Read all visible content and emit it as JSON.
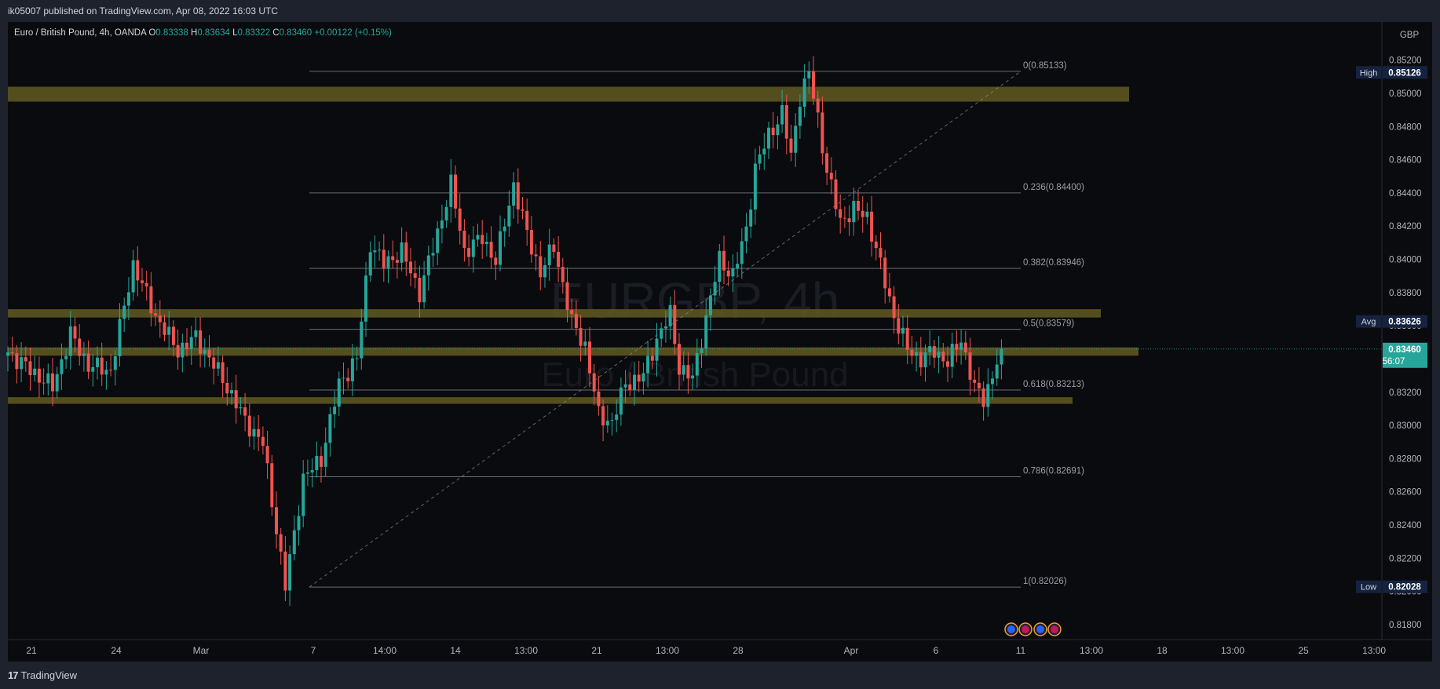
{
  "header": {
    "published": "ik05007 published on TradingView.com, Apr 08, 2022 16:03 UTC"
  },
  "footer": {
    "brand": "TradingView",
    "brand_icon": "tradingview-logo"
  },
  "colors": {
    "up": "#26a69a",
    "down": "#ef5350",
    "zone": "#5c5521",
    "fib": "#8a8d94",
    "fibText": "#9b9ea6",
    "bg": "#0a0b0e",
    "panel": "#1e222d",
    "price": "#26a69a",
    "labelBox": "#152340"
  },
  "chart_data": {
    "type": "candlestick",
    "title": "Euro / British Pound, 4h, OANDA",
    "ohlc_legend": {
      "o_label": "O",
      "o": "0.83338",
      "h_label": "H",
      "h": "0.83634",
      "l_label": "L",
      "l": "0.83322",
      "c_label": "C",
      "c": "0.83460",
      "change": "+0.00122 (+0.15%)"
    },
    "currency": "GBP",
    "watermark": [
      "EURGBP, 4h",
      "Euro / British Pound"
    ],
    "ylim": [
      0.8171,
      0.8543
    ],
    "y_ticks": [
      "0.85200",
      "0.85000",
      "0.84800",
      "0.84600",
      "0.84400",
      "0.84200",
      "0.84000",
      "0.83800",
      "0.83600",
      "0.83400",
      "0.83200",
      "0.83000",
      "0.82800",
      "0.82600",
      "0.82400",
      "0.82200",
      "0.82000",
      "0.81800"
    ],
    "x_ticks": [
      "21",
      "24",
      "Mar",
      "7",
      "14:00",
      "14",
      "13:00",
      "21",
      "13:00",
      "28",
      "Apr",
      "6",
      "11",
      "13:00",
      "18",
      "13:00",
      "25",
      "13:00"
    ],
    "zones": [
      [
        0.8495,
        0.8504
      ],
      [
        0.8365,
        0.837
      ],
      [
        0.8342,
        0.8347
      ],
      [
        0.8313,
        0.8317
      ]
    ],
    "fib_levels": [
      {
        "label": "0(0.85133)",
        "value": 0.85133
      },
      {
        "label": "0.236(0.84400)",
        "value": 0.844
      },
      {
        "label": "0.382(0.83946)",
        "value": 0.83946
      },
      {
        "label": "0.5(0.83579)",
        "value": 0.83579
      },
      {
        "label": "0.618(0.83213)",
        "value": 0.83213
      },
      {
        "label": "0.786(0.82691)",
        "value": 0.82691
      },
      {
        "label": "1(0.82026)",
        "value": 0.82026
      }
    ],
    "price_labels": [
      {
        "name": "High",
        "value": "0.85126",
        "price": 0.85126
      },
      {
        "name": "Avg",
        "value": "0.83626",
        "price": 0.83626
      },
      {
        "name": "Low",
        "value": "0.82028",
        "price": 0.82028
      }
    ],
    "last_price": {
      "value": "0.83460",
      "price": 0.8346,
      "countdown": "56:07"
    },
    "waypoints": [
      [
        0,
        0.8344
      ],
      [
        10,
        0.8323
      ],
      [
        14,
        0.8355
      ],
      [
        18,
        0.8336
      ],
      [
        23,
        0.8333
      ],
      [
        28,
        0.8397
      ],
      [
        33,
        0.8366
      ],
      [
        38,
        0.8345
      ],
      [
        42,
        0.8353
      ],
      [
        48,
        0.8328
      ],
      [
        53,
        0.8303
      ],
      [
        57,
        0.8289
      ],
      [
        62,
        0.8203
      ],
      [
        66,
        0.8268
      ],
      [
        70,
        0.828
      ],
      [
        74,
        0.8325
      ],
      [
        78,
        0.834
      ],
      [
        81,
        0.841
      ],
      [
        84,
        0.8397
      ],
      [
        88,
        0.8405
      ],
      [
        92,
        0.838
      ],
      [
        96,
        0.8416
      ],
      [
        99,
        0.8445
      ],
      [
        102,
        0.8405
      ],
      [
        106,
        0.8413
      ],
      [
        109,
        0.8399
      ],
      [
        113,
        0.8445
      ],
      [
        116,
        0.8415
      ],
      [
        119,
        0.8392
      ],
      [
        122,
        0.8408
      ],
      [
        126,
        0.8362
      ],
      [
        129,
        0.8348
      ],
      [
        132,
        0.8306
      ],
      [
        135,
        0.8302
      ],
      [
        138,
        0.8325
      ],
      [
        142,
        0.833
      ],
      [
        145,
        0.8352
      ],
      [
        148,
        0.8367
      ],
      [
        150,
        0.8335
      ],
      [
        153,
        0.8328
      ],
      [
        156,
        0.8365
      ],
      [
        159,
        0.84
      ],
      [
        162,
        0.839
      ],
      [
        165,
        0.8418
      ],
      [
        167,
        0.8455
      ],
      [
        170,
        0.8475
      ],
      [
        173,
        0.8488
      ],
      [
        175,
        0.8462
      ],
      [
        177,
        0.8498
      ],
      [
        179,
        0.8512
      ],
      [
        181,
        0.8485
      ],
      [
        183,
        0.8453
      ],
      [
        186,
        0.8423
      ],
      [
        189,
        0.843
      ],
      [
        192,
        0.8426
      ],
      [
        195,
        0.8396
      ],
      [
        198,
        0.8366
      ],
      [
        201,
        0.8346
      ],
      [
        204,
        0.834
      ],
      [
        207,
        0.8345
      ],
      [
        210,
        0.8338
      ],
      [
        213,
        0.8352
      ],
      [
        216,
        0.8322
      ],
      [
        218,
        0.8316
      ],
      [
        220,
        0.833
      ],
      [
        222,
        0.8346
      ]
    ]
  }
}
